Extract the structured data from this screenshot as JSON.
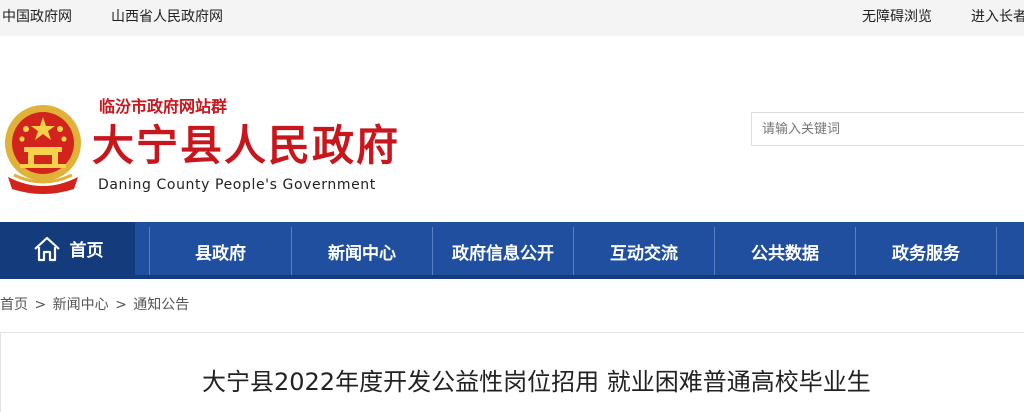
{
  "topbar": {
    "links": [
      "中国政府网",
      "山西省人民政府网"
    ],
    "accessibility": "无障碍浏览",
    "elder_mode": "进入长者"
  },
  "header": {
    "site_group": "临汾市政府网站群",
    "title": "大宁县人民政府",
    "subtitle": "Daning County People's Government",
    "search_placeholder": "请输入关键词"
  },
  "nav": {
    "items": [
      "首页",
      "县政府",
      "新闻中心",
      "政府信息公开",
      "互动交流",
      "公共数据",
      "政务服务"
    ]
  },
  "breadcrumb": [
    "首页",
    "新闻中心",
    "通知公告"
  ],
  "article": {
    "title": "大宁县2022年度开发公益性岗位招用 就业困难普通高校毕业生"
  },
  "colors": {
    "brand_red": "#c8161d",
    "nav_blue": "#1f4f9e",
    "nav_dark": "#143b7c"
  }
}
